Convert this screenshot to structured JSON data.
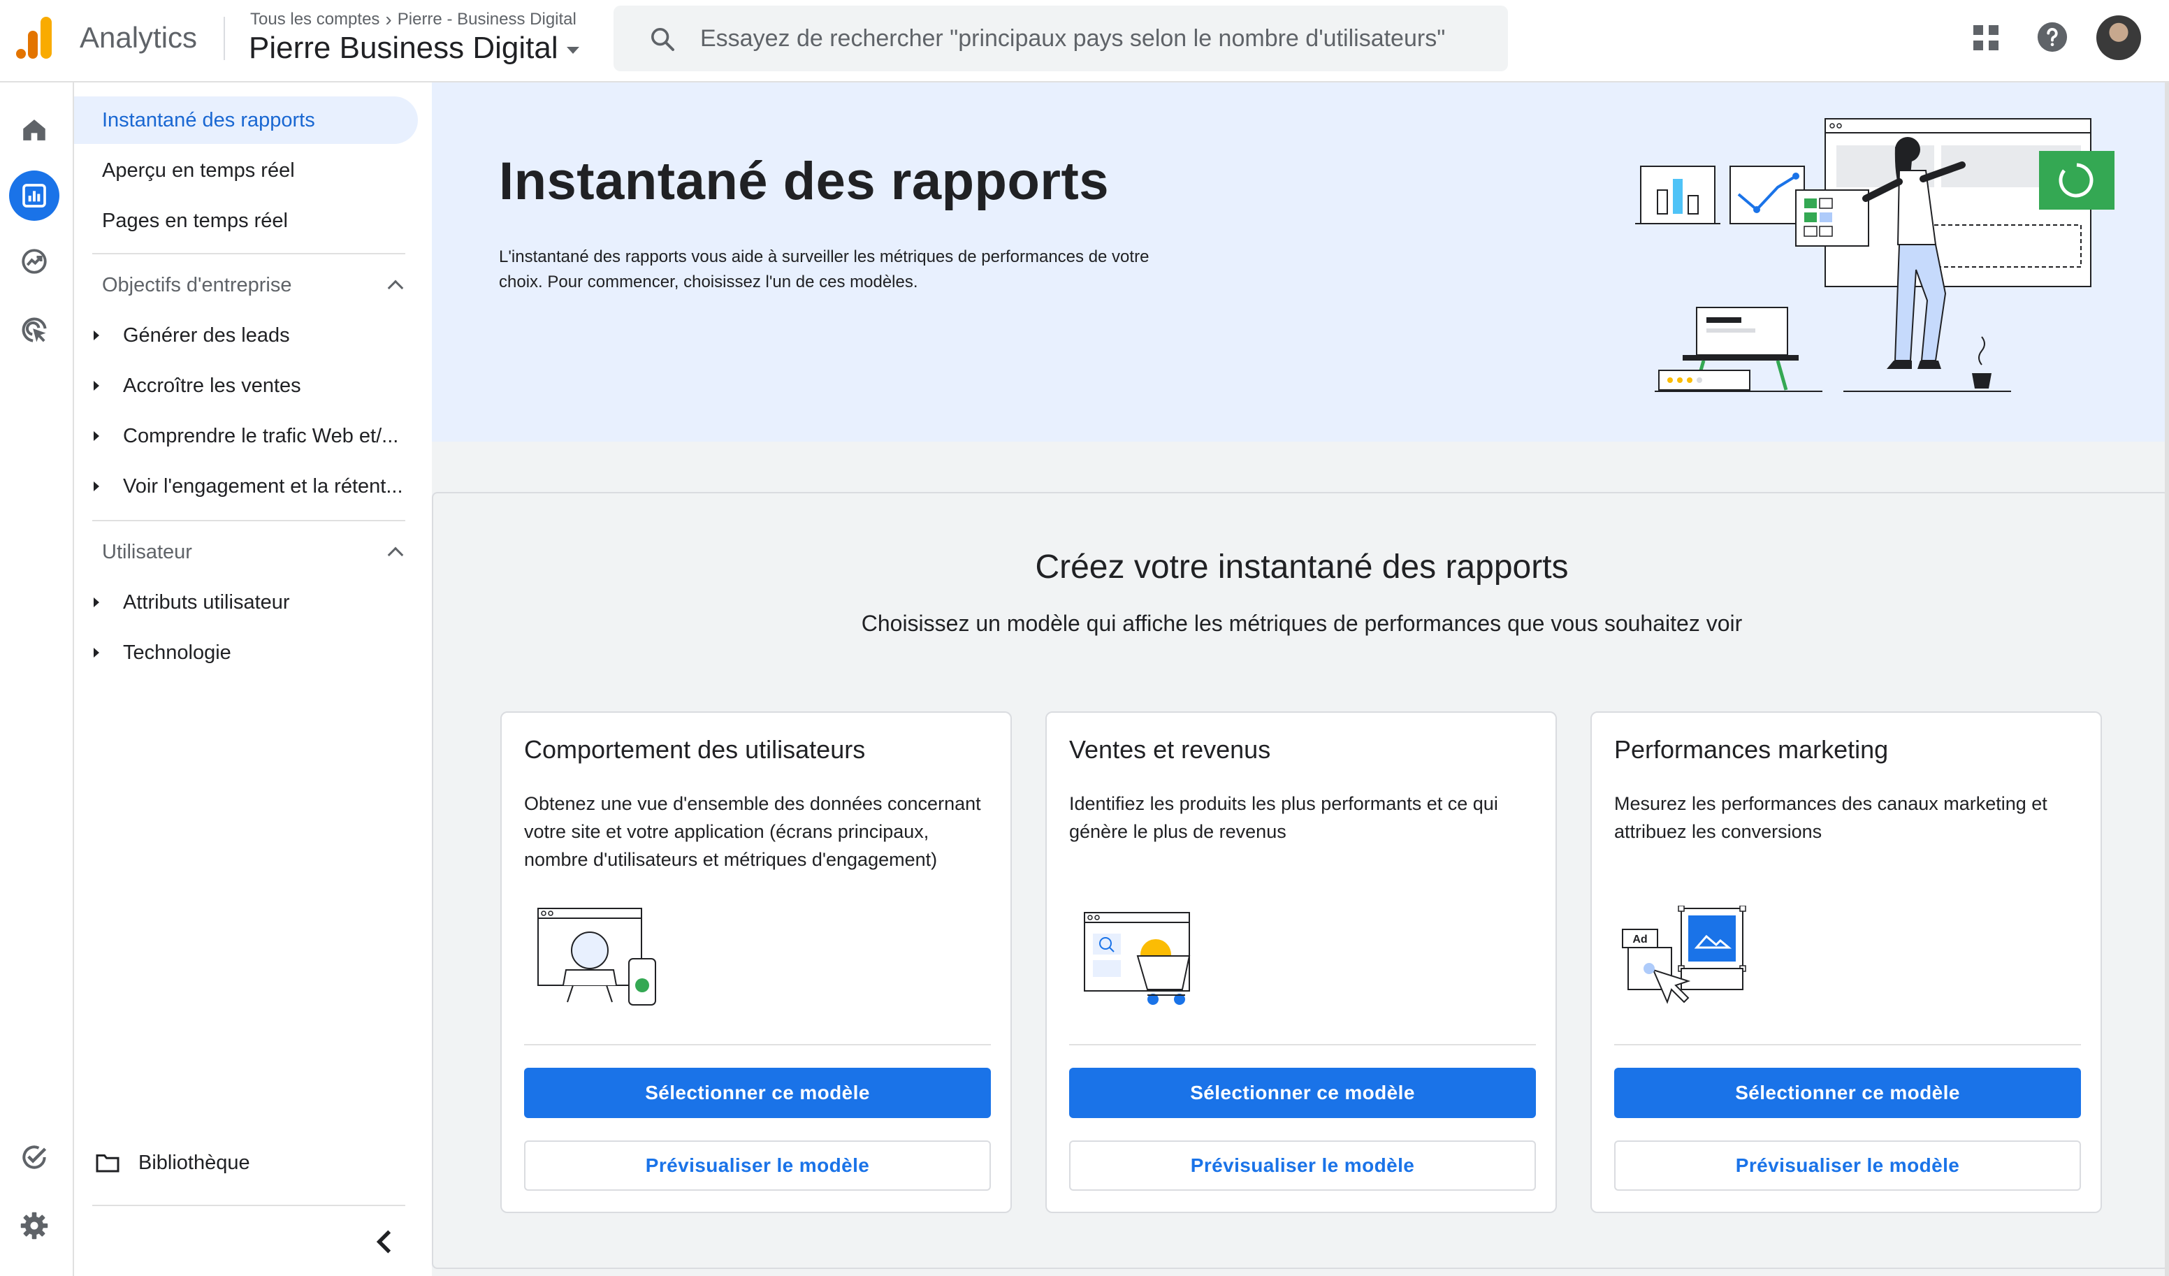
{
  "header": {
    "app_name": "Analytics",
    "breadcrumb": [
      "Tous les comptes",
      "Pierre - Business Digital"
    ],
    "property": "Pierre Business Digital",
    "search_placeholder": "Essayez de rechercher \"principaux pays selon le nombre d'utilisateurs\"",
    "icons": [
      "apps-grid-icon",
      "help-icon",
      "avatar"
    ]
  },
  "rail": {
    "items": [
      {
        "icon": "home-icon",
        "active": false
      },
      {
        "icon": "reports-icon",
        "active": true
      },
      {
        "icon": "explore-icon",
        "active": false
      },
      {
        "icon": "advertising-icon",
        "active": false
      }
    ],
    "bottom": [
      {
        "icon": "admin-check-icon"
      },
      {
        "icon": "settings-gear-icon"
      }
    ]
  },
  "nav": {
    "top_items": [
      {
        "label": "Instantané des rapports",
        "active": true
      },
      {
        "label": "Aperçu en temps réel"
      },
      {
        "label": "Pages en temps réel"
      }
    ],
    "sections": [
      {
        "title": "Objectifs d'entreprise",
        "items": [
          "Générer des leads",
          "Accroître les ventes",
          "Comprendre le trafic Web et/...",
          "Voir l'engagement et la rétent..."
        ]
      },
      {
        "title": "Utilisateur",
        "items": [
          "Attributs utilisateur",
          "Technologie"
        ]
      }
    ],
    "library": "Bibliothèque"
  },
  "hero": {
    "title": "Instantané des rapports",
    "description": "L'instantané des rapports vous aide à surveiller les métriques de performances de votre choix. Pour commencer, choisissez l'un de ces modèles."
  },
  "templates": {
    "title": "Créez votre instantané des rapports",
    "subtitle": "Choisissez un modèle qui affiche les métriques de performances que vous souhaitez voir",
    "cards": [
      {
        "title": "Comportement des utilisateurs",
        "description": "Obtenez une vue d'ensemble des données concernant votre site et votre application (écrans principaux, nombre d'utilisateurs et métriques d'engagement)",
        "select_label": "Sélectionner ce modèle",
        "preview_label": "Prévisualiser le modèle"
      },
      {
        "title": "Ventes et revenus",
        "description": "Identifiez les produits les plus performants et ce qui génère le plus de revenus",
        "select_label": "Sélectionner ce modèle",
        "preview_label": "Prévisualiser le modèle"
      },
      {
        "title": "Performances marketing",
        "description": "Mesurez les performances des canaux marketing et attribuez les conversions",
        "select_label": "Sélectionner ce modèle",
        "preview_label": "Prévisualiser le modèle",
        "ad_label": "Ad"
      }
    ]
  },
  "colors": {
    "primary": "#1a73e8",
    "hero_bg": "#e8f0fe",
    "main_bg": "#f1f3f4",
    "logo_orange": "#f9ab00",
    "logo_dark_orange": "#e37400"
  }
}
